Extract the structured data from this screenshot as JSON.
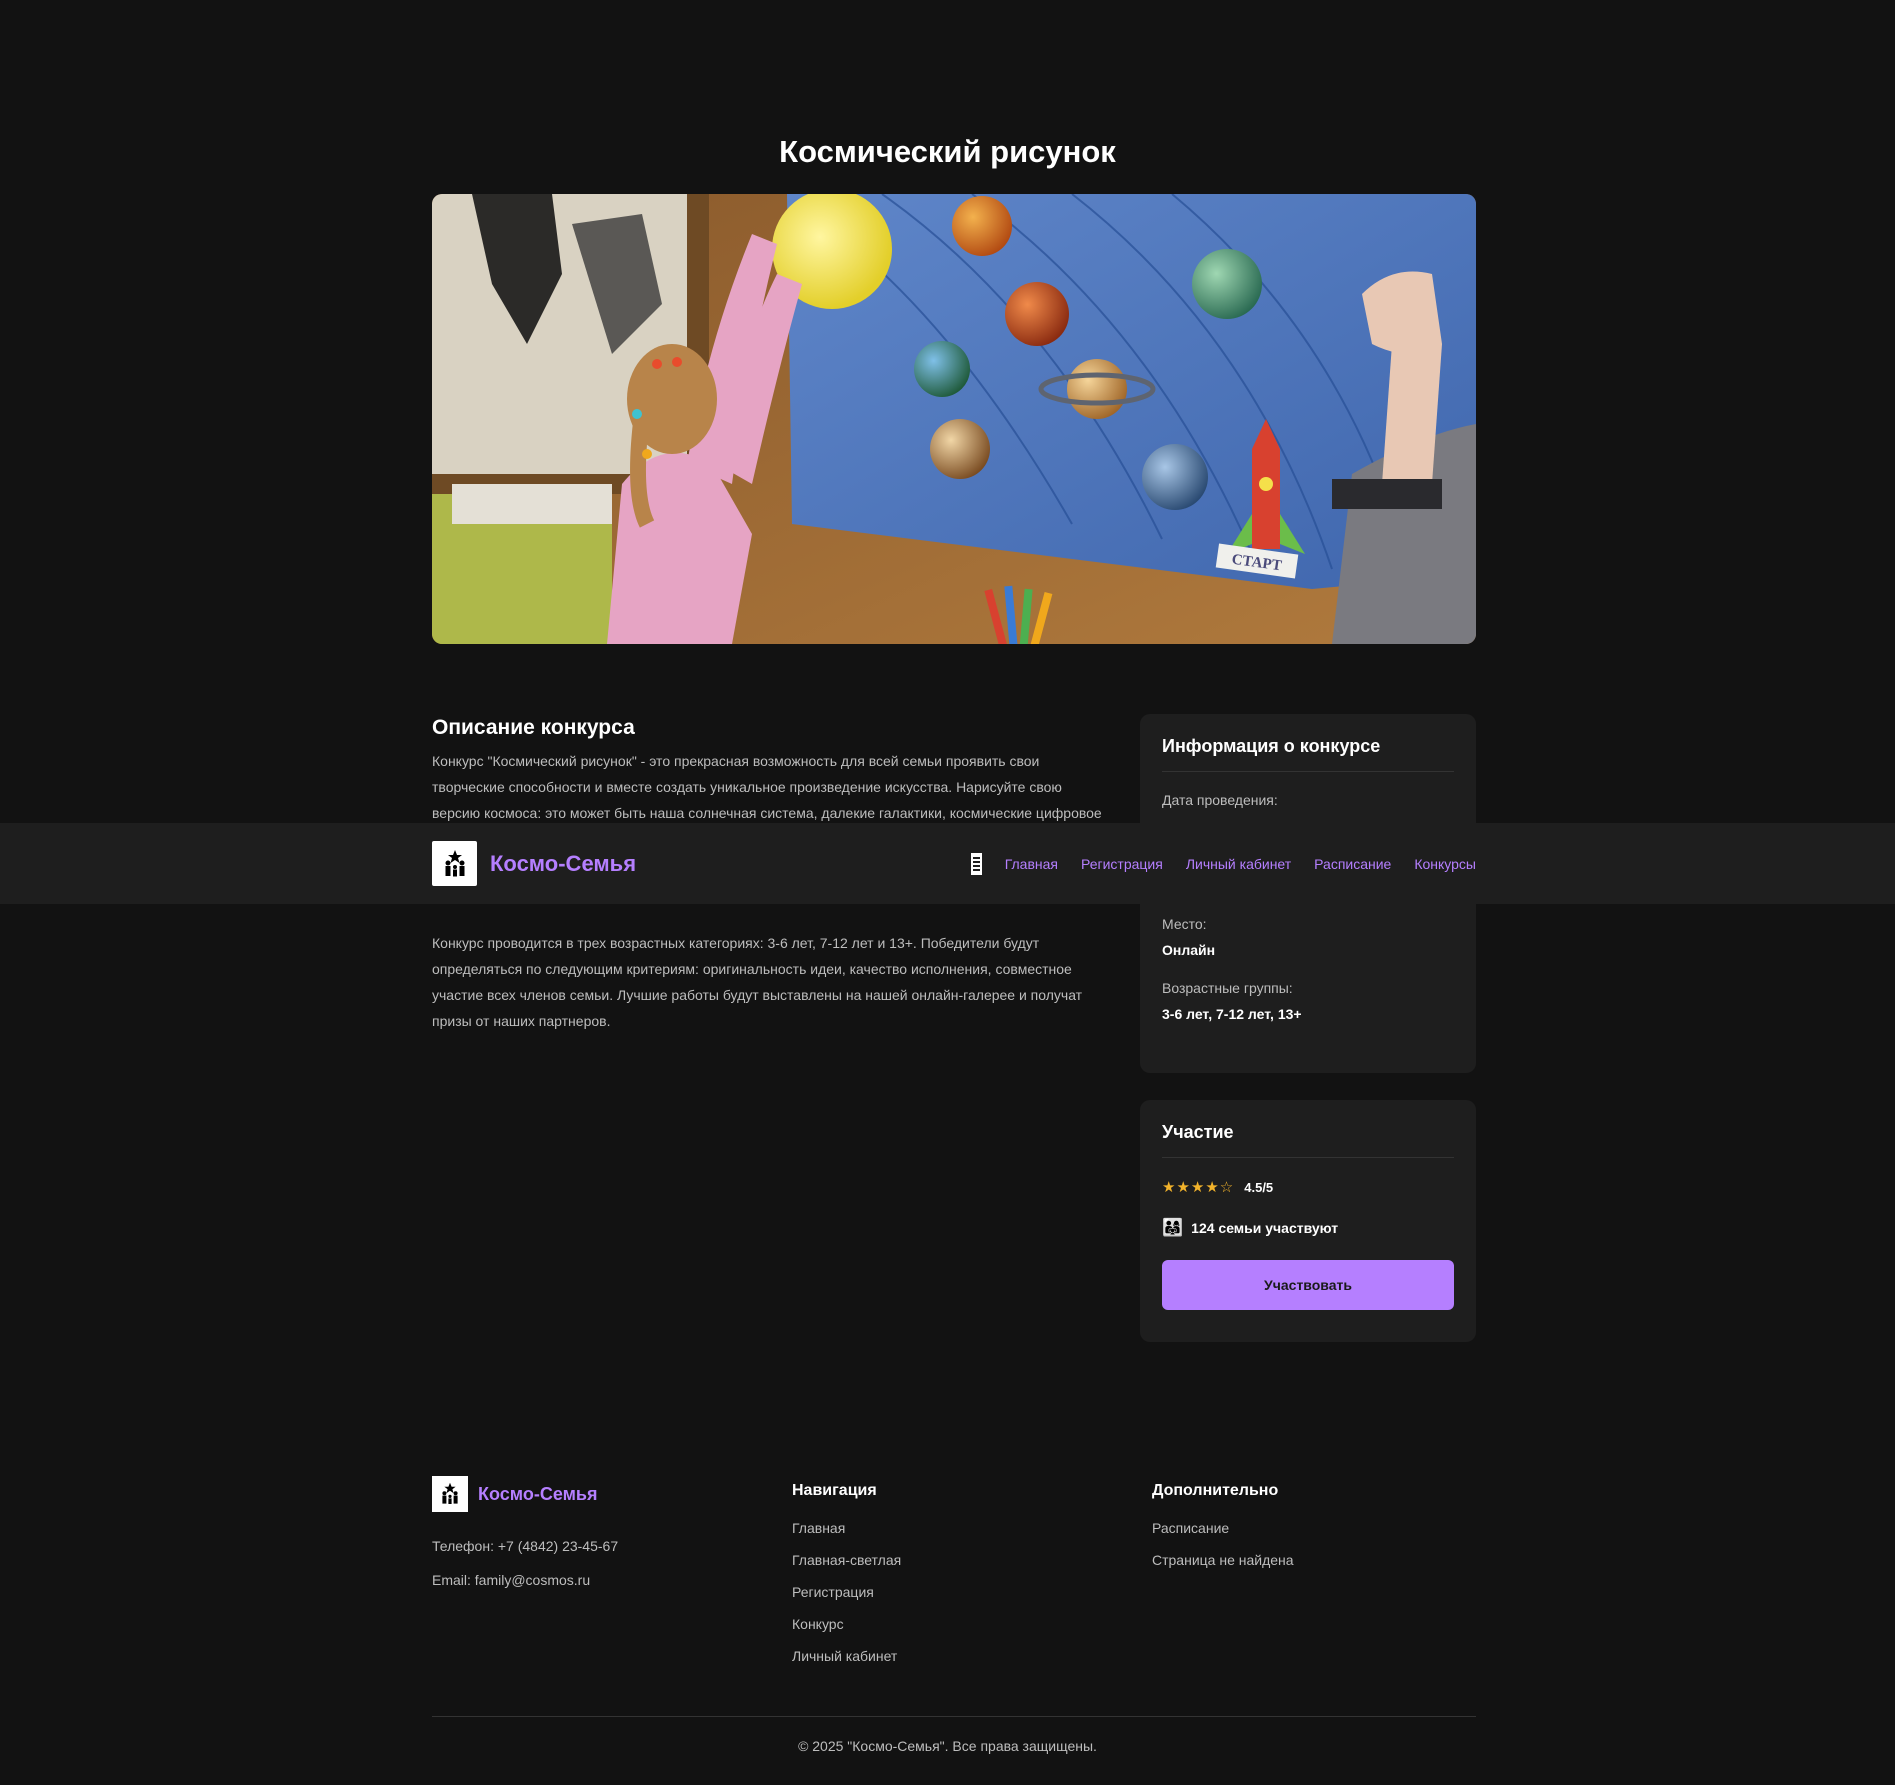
{
  "page": {
    "title": "Космический рисунок"
  },
  "description": {
    "heading": "Описание конкурса",
    "paragraph_1": "Конкурс \"Космический рисунок\" - это прекрасная возможность для всей семьи проявить свои творческие способности и вместе создать уникальное произведение искусства. Нарисуйте свою версию космоса: это может быть наша солнечная система, далекие галактики, космические цифровое искусство. Главное - чтобы работа была выполнена совместно всеми членами семьи. Для участия необходимо загрузить фотографию вашего рисунка через личный кабинет и заполнить краткое описание работы.",
    "paragraph_2": "Конкурс проводится в трех возрастных категориях: 3-6 лет, 7-12 лет и 13+. Победители будут определяться по следующим критериям: оригинальность идеи, качество исполнения, совместное участие всех членов семьи. Лучшие работы будут выставлены на нашей онлайн-галерее и получат призы от наших партнеров."
  },
  "info_card": {
    "title": "Информация о конкурсе",
    "date_label": "Дата проведения:",
    "place_label": "Место:",
    "place_value": "Онлайн",
    "ages_label": "Возрастные группы:",
    "ages_value": "3-6 лет, 7-12 лет, 13+"
  },
  "participation_card": {
    "title": "Участие",
    "stars": "★★★★☆",
    "rating": "4.5/5",
    "families_icon": "👨‍👩‍👧",
    "families_text": "124 семьи участвуют",
    "button_label": "Участвовать"
  },
  "header": {
    "brand": "Космо-Семья",
    "logo_icon": "family-star-icon",
    "nav": [
      "Главная",
      "Регистрация",
      "Личный кабинет",
      "Расписание",
      "Конкурсы"
    ]
  },
  "footer": {
    "brand": "Космо-Семья",
    "phone": "Телефон: +7 (4842) 23-45-67",
    "email": "Email: family@cosmos.ru",
    "nav_heading": "Навигация",
    "nav_links": [
      "Главная",
      "Главная-светлая",
      "Регистрация",
      "Конкурс",
      "Личный кабинет"
    ],
    "extra_heading": "Дополнительно",
    "extra_links": [
      "Расписание",
      "Страница не найдена"
    ],
    "copyright": "© 2025 \"Космо-Семья\". Все права защищены."
  },
  "hero_image": {
    "caption": "СТАРТ"
  },
  "colors": {
    "accent": "#b57fff",
    "background": "#121212",
    "card": "#1e1e1e",
    "star": "#f2b32b"
  }
}
